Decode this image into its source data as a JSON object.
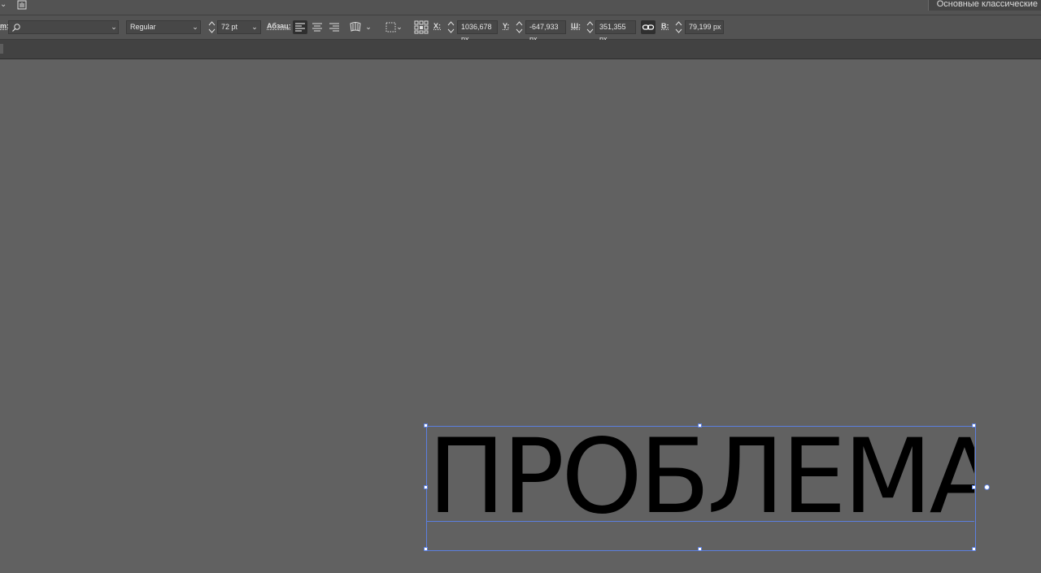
{
  "workspace": {
    "label": "Основные классические"
  },
  "control_bar": {
    "font_family_label": "m:",
    "font_family_value": "",
    "font_style_value": "Regular",
    "font_size_value": "72 pt",
    "paragraph_label": "Абзац:",
    "x_label": "X:",
    "x_value": "1036,678 px",
    "y_label": "Y:",
    "y_value": "-647,933 px",
    "w_label": "Ш:",
    "w_value": "351,355 px",
    "h_label": "В:",
    "h_value": "79,199 px",
    "icons": [
      "search-icon",
      "chevron-down-icon",
      "align-left-icon",
      "align-center-icon",
      "align-right-icon",
      "envelope-warp-icon",
      "selection-grid-icon",
      "reference-point-icon",
      "link-proportions-icon"
    ]
  },
  "artboard": {
    "text": "ПРОБЛЕМА"
  },
  "colors": {
    "selection": "#5b7fe0",
    "canvas": "#616161",
    "bar": "#535353"
  }
}
